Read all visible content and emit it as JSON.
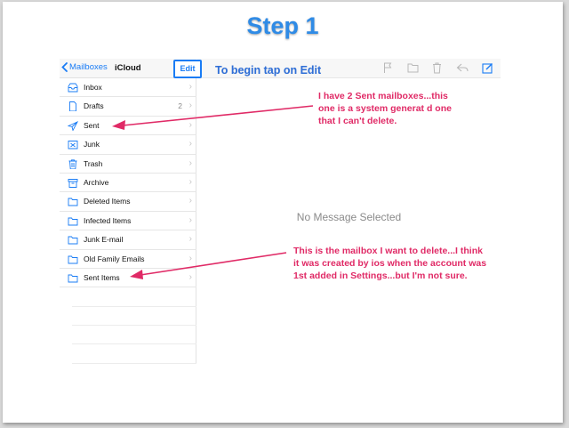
{
  "step_title": "Step 1",
  "instruction": "To begin tap on Edit",
  "nav": {
    "back_label": "Mailboxes",
    "title": "iCloud",
    "edit_label": "Edit"
  },
  "mailboxes": [
    {
      "label": "Inbox",
      "icon": "inbox-icon",
      "count": ""
    },
    {
      "label": "Drafts",
      "icon": "drafts-icon",
      "count": "2"
    },
    {
      "label": "Sent",
      "icon": "sent-icon",
      "count": ""
    },
    {
      "label": "Junk",
      "icon": "junk-icon",
      "count": ""
    },
    {
      "label": "Trash",
      "icon": "trash-icon",
      "count": ""
    },
    {
      "label": "Archive",
      "icon": "archive-icon",
      "count": ""
    },
    {
      "label": "Deleted Items",
      "icon": "folder-icon",
      "count": ""
    },
    {
      "label": "Infected Items",
      "icon": "folder-icon",
      "count": ""
    },
    {
      "label": "Junk E-mail",
      "icon": "folder-icon",
      "count": ""
    },
    {
      "label": "Old Family Emails",
      "icon": "folder-icon",
      "count": ""
    },
    {
      "label": "Sent Items",
      "icon": "folder-icon",
      "count": ""
    }
  ],
  "content": {
    "empty_text": "No Message Selected"
  },
  "annotations": {
    "sent_note": [
      "I have 2 Sent mailboxes...this",
      "one is a system generat d one",
      "that I can't delete."
    ],
    "sent_items_note": [
      "This is the mailbox I want to delete...I think",
      "it was created by ios when the account was",
      "1st added in Settings...but I'm not sure."
    ]
  },
  "colors": {
    "accent": "#1a7cf5",
    "annotation": "#e02a66",
    "title": "#2f8be6"
  }
}
